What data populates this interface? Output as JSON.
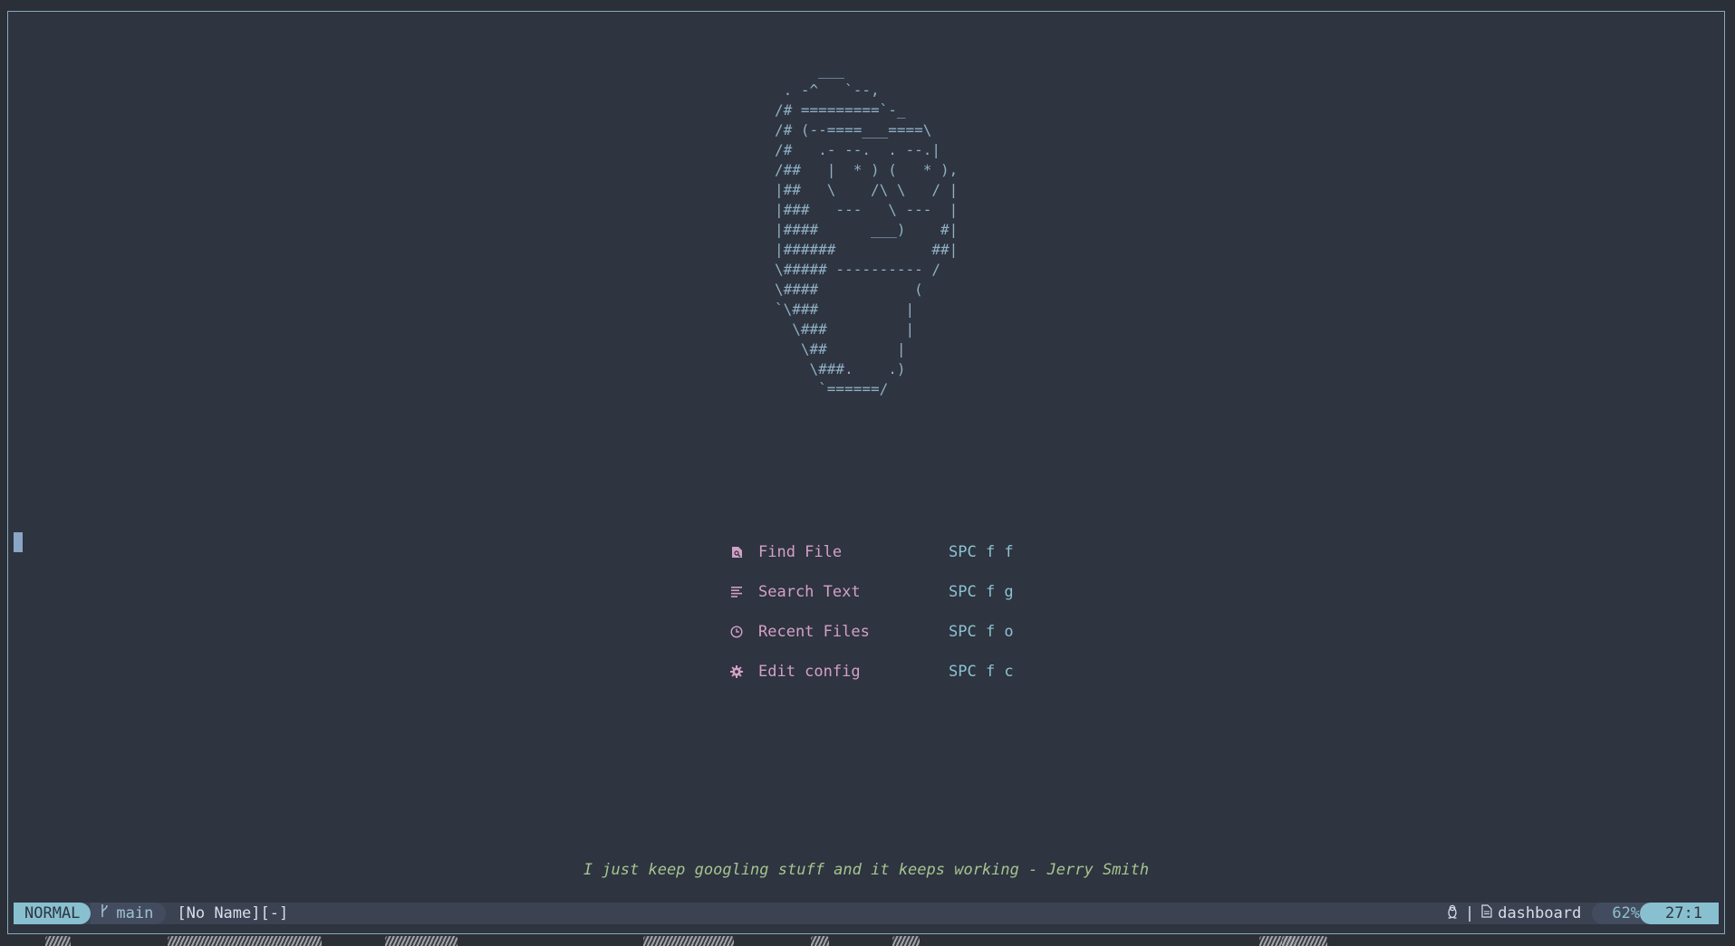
{
  "ascii_header": "     ___\n . -^   `--,\n/# =========`-_\n/# (--====___====\\\n/#   .- --.  . --.|\n/##   |  * ) (   * ),\n|##   \\    /\\ \\   / |\n|###   ---   \\ ---  |\n|####      ___)    #|\n|######           ##|\n\\##### ---------- /\n\\####           (\n`\\###          |\n  \\###         |\n   \\##        |\n    \\###.    .)\n     `======/",
  "menu": {
    "items": [
      {
        "icon": "find-file-icon",
        "label": "Find File",
        "key": "SPC f f"
      },
      {
        "icon": "search-text-icon",
        "label": "Search Text",
        "key": "SPC f g"
      },
      {
        "icon": "clock-icon",
        "label": "Recent Files",
        "key": "SPC f o"
      },
      {
        "icon": "gear-icon",
        "label": "Edit config",
        "key": "SPC f c"
      }
    ]
  },
  "quote": "I just keep googling stuff and it keeps working - Jerry Smith",
  "statusline": {
    "mode": "NORMAL",
    "branch_icon": "git-branch-icon",
    "branch": "main",
    "filename": "[No Name][-]",
    "os_icon": "linux-tux-icon",
    "separator": "|",
    "filetype_icon": "file-icon",
    "filetype": "dashboard",
    "percent": "62%",
    "position": "27:1"
  },
  "colors": {
    "background": "#2e3440",
    "ascii": "#8fb0c4",
    "menu_label": "#d3a0c7",
    "menu_key": "#8cc2d2",
    "quote": "#a6c48f",
    "mode_bg": "#88c0d0"
  }
}
